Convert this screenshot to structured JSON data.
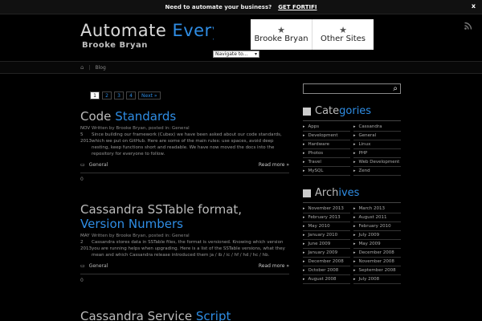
{
  "promo": {
    "text": "Need to automate your business?",
    "cta": "GET FORTIFI",
    "close": "x"
  },
  "header": {
    "title_a": "Automate",
    "title_b": "Everything",
    "author": "Brooke Bryan",
    "nav": [
      {
        "label": "Brooke Bryan"
      },
      {
        "label": "Other Sites"
      }
    ],
    "select": "Navigate to..."
  },
  "breadcrumb": {
    "item": "Blog"
  },
  "pagination": [
    "1",
    "2",
    "3",
    "4",
    "Next »"
  ],
  "posts": [
    {
      "title_a": "Code",
      "title_b": "Standards",
      "meta": "Written by Brooke Bryan, posted in: General",
      "date": "NOV 5 2013",
      "text": "Since building our framework (Cubex) we have been asked about our code standards, which we put on GitHub. Here are some of the main rules: use spaces, avoid deep nesting, keep functions short and readable. We have now moved the docs into the repository for everyone to follow.",
      "category": "General",
      "more": "Read more »",
      "tag": "0"
    },
    {
      "title_a": "Cassandra SSTable format,",
      "title_b": "Version Numbers",
      "meta": "Written by Brooke Bryan, posted in: General",
      "date": "MAY 2 2013",
      "text": "Cassandra stores data in SSTable files, the format is versioned. Knowing which version you are running helps when upgrading. Here is a list of the SSTable versions, what they mean and which Cassandra release introduced them ja / ib / ic / hf / hd / hc / hb.",
      "category": "General",
      "more": "Read more »",
      "tag": "0"
    },
    {
      "title_a": "Cassandra Service",
      "title_b": "Script"
    }
  ],
  "sidebar": {
    "search_placeholder": "",
    "categories_title_a": "Cate",
    "categories_title_b": "gories",
    "categories": [
      "Apps",
      "Cassandra",
      "Development",
      "General",
      "Hardware",
      "Linux",
      "Photos",
      "PHP",
      "Travel",
      "Web Development",
      "MySQL",
      "Zend"
    ],
    "archives_title_a": "Arch",
    "archives_title_b": "ives",
    "archives": [
      "November 2013",
      "March 2013",
      "February 2013",
      "August 2011",
      "May 2010",
      "February 2010",
      "January 2010",
      "July 2009",
      "June 2009",
      "May 2009",
      "January 2009",
      "December 2008",
      "December 2008",
      "November 2008",
      "October 2008",
      "September 2008",
      "August 2008",
      "July 2008"
    ]
  },
  "colors": {
    "accent": "#2f8de4",
    "background": "#000000"
  }
}
